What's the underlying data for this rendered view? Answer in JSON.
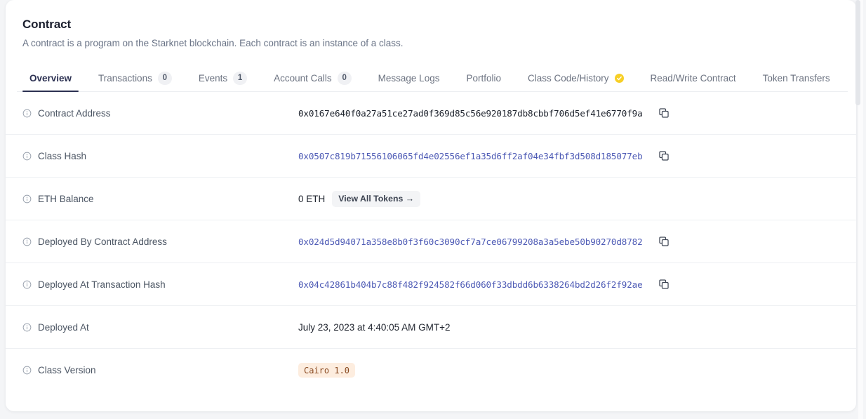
{
  "header": {
    "title": "Contract",
    "subtitle": "A contract is a program on the Starknet blockchain. Each contract is an instance of a class."
  },
  "tabs": [
    {
      "label": "Overview",
      "count": null,
      "verified": false,
      "active": true
    },
    {
      "label": "Transactions",
      "count": "0",
      "verified": false,
      "active": false
    },
    {
      "label": "Events",
      "count": "1",
      "verified": false,
      "active": false
    },
    {
      "label": "Account Calls",
      "count": "0",
      "verified": false,
      "active": false
    },
    {
      "label": "Message Logs",
      "count": null,
      "verified": false,
      "active": false
    },
    {
      "label": "Portfolio",
      "count": null,
      "verified": false,
      "active": false
    },
    {
      "label": "Class Code/History",
      "count": null,
      "verified": true,
      "active": false
    },
    {
      "label": "Read/Write Contract",
      "count": null,
      "verified": false,
      "active": false
    },
    {
      "label": "Token Transfers",
      "count": null,
      "verified": false,
      "active": false
    }
  ],
  "rows": [
    {
      "label": "Contract Address",
      "value": "0x0167e640f0a27a51ce27ad0f369d85c56e920187db8cbbf706d5ef41e6770f9a",
      "style": "mono-plain",
      "copy": true
    },
    {
      "label": "Class Hash",
      "value": "0x0507c819b71556106065fd4e02556ef1a35d6ff2af04e34fbf3d508d185077eb",
      "style": "mono-link",
      "copy": true
    },
    {
      "label": "ETH Balance",
      "value": "0 ETH",
      "style": "text",
      "copy": false,
      "button": "View All Tokens →"
    },
    {
      "label": "Deployed By Contract Address",
      "value": "0x024d5d94071a358e8b0f3f60c3090cf7a7ce06799208a3a5ebe50b90270d8782",
      "style": "mono-link",
      "copy": true
    },
    {
      "label": "Deployed At Transaction Hash",
      "value": "0x04c42861b404b7c88f482f924582f66d060f33dbdd6b6338264bd2d26f2f92ae",
      "style": "mono-link",
      "copy": true
    },
    {
      "label": "Deployed At",
      "value": "July 23, 2023 at 4:40:05 AM GMT+2",
      "style": "text",
      "copy": false
    },
    {
      "label": "Class Version",
      "value": "Cairo 1.0",
      "style": "tag",
      "copy": false
    }
  ],
  "colors": {
    "accent": "#2c3152",
    "link": "#4d5ab5",
    "verified_badge": "#f7cf26",
    "tag_background": "#fdeddf",
    "tag_text": "#8a4b22"
  },
  "icons": {
    "info": "info-circle-icon",
    "copy": "copy-icon",
    "verified": "verified-check-icon"
  }
}
